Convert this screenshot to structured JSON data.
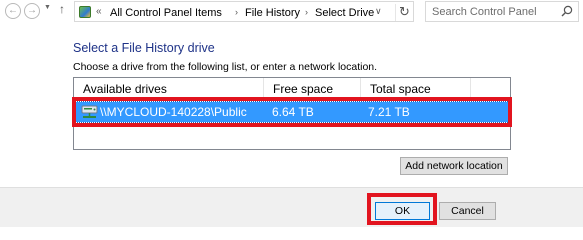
{
  "nav": {
    "back_glyph": "←",
    "forward_glyph": "→",
    "recent_glyph": "▼",
    "up_glyph": "↑"
  },
  "address": {
    "overflow": "«",
    "crumbs": [
      "All Control Panel Items",
      "File History",
      "Select Drive"
    ],
    "separator": "›",
    "dropdown_glyph": "∨",
    "refresh_glyph": "↻"
  },
  "search": {
    "placeholder": "Search Control Panel"
  },
  "main": {
    "title": "Select a File History drive",
    "instructions": "Choose a drive from the following list, or enter a network location."
  },
  "drive_list": {
    "columns": [
      "Available drives",
      "Free space",
      "Total space"
    ],
    "rows": [
      {
        "name": "\\\\MYCLOUD-140228\\Public",
        "free": "6.64 TB",
        "total": "7.21 TB",
        "selected": true
      }
    ]
  },
  "buttons": {
    "add_network": "Add network location",
    "ok": "OK",
    "cancel": "Cancel"
  },
  "colors": {
    "title": "#1e3287",
    "selection": "#3399ff",
    "highlight": "#e2141f",
    "footer": "#f0f0f0"
  },
  "icons": {
    "address": "control-panel-icon",
    "search": "search-icon",
    "drive": "network-drive-icon"
  }
}
